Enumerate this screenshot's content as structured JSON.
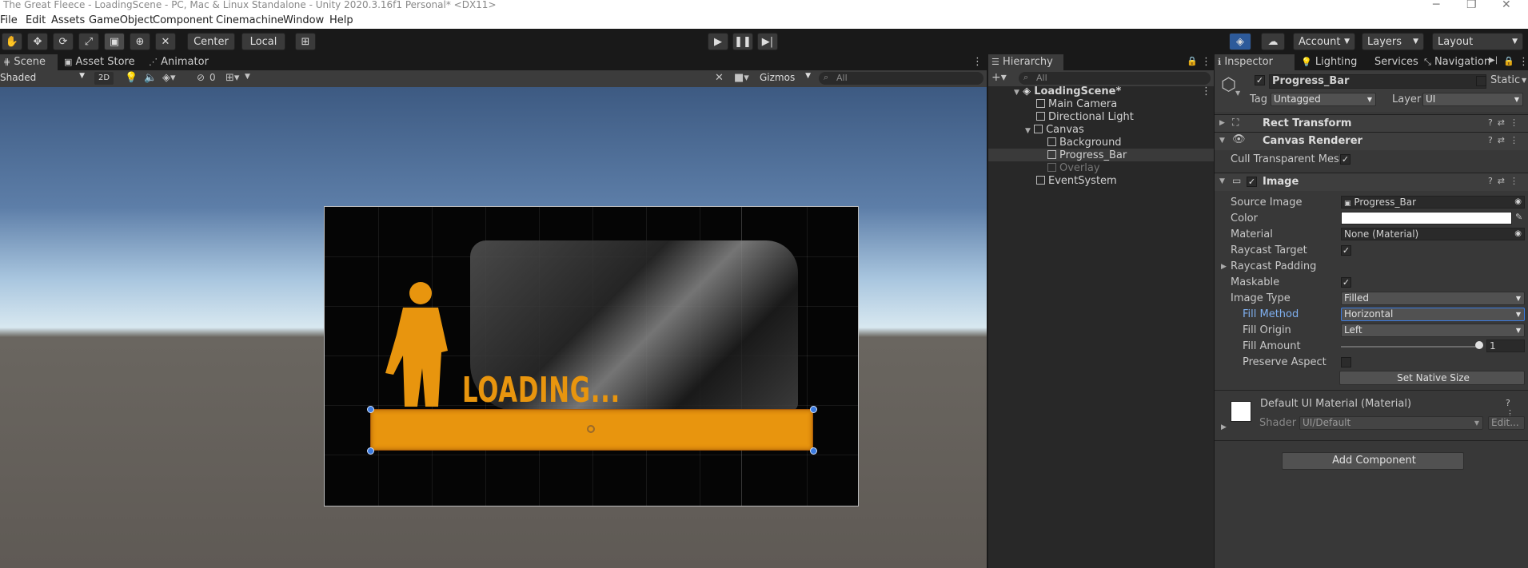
{
  "window": {
    "title": "The Great Fleece - LoadingScene - PC, Mac & Linux Standalone - Unity 2020.3.16f1 Personal* <DX11>"
  },
  "menu": [
    "File",
    "Edit",
    "Assets",
    "GameObject",
    "Component",
    "Cinemachine",
    "Window",
    "Help"
  ],
  "toolbar": {
    "pivot": "Center",
    "space": "Local",
    "account": "Account",
    "layers": "Layers",
    "layout": "Layout"
  },
  "scene_panel": {
    "tabs": [
      "Scene",
      "Asset Store",
      "Animator"
    ],
    "shading": "Shaded",
    "mode_2d": "2D",
    "hidden_count": "0",
    "gizmos": "Gizmos",
    "search_placeholder": "All",
    "canvas_text": "LOADING..."
  },
  "hierarchy": {
    "tab": "Hierarchy",
    "search_placeholder": "All",
    "items": [
      {
        "label": "LoadingScene*"
      },
      {
        "label": "Main Camera"
      },
      {
        "label": "Directional Light"
      },
      {
        "label": "Canvas"
      },
      {
        "label": "Background"
      },
      {
        "label": "Progress_Bar"
      },
      {
        "label": "Overlay"
      },
      {
        "label": "EventSystem"
      }
    ]
  },
  "inspector": {
    "tabs": [
      "Inspector",
      "Lighting",
      "Services",
      "Navigation"
    ],
    "object_name": "Progress_Bar",
    "static_label": "Static",
    "tag_label": "Tag",
    "tag_value": "Untagged",
    "layer_label": "Layer",
    "layer_value": "UI",
    "components": {
      "rect_transform": "Rect Transform",
      "canvas_renderer": "Canvas Renderer",
      "cull_transparent": "Cull Transparent Mesh",
      "image": "Image"
    },
    "image": {
      "source_image_label": "Source Image",
      "source_image_value": "Progress_Bar",
      "color_label": "Color",
      "material_label": "Material",
      "material_value": "None (Material)",
      "raycast_target_label": "Raycast Target",
      "raycast_padding_label": "Raycast Padding",
      "maskable_label": "Maskable",
      "image_type_label": "Image Type",
      "image_type_value": "Filled",
      "fill_method_label": "Fill Method",
      "fill_method_value": "Horizontal",
      "fill_origin_label": "Fill Origin",
      "fill_origin_value": "Left",
      "fill_amount_label": "Fill Amount",
      "fill_amount_value": "1",
      "preserve_aspect_label": "Preserve Aspect",
      "set_native_size": "Set Native Size"
    },
    "material": {
      "title": "Default UI Material (Material)",
      "shader_label": "Shader",
      "shader_value": "UI/Default",
      "edit_label": "Edit..."
    },
    "add_component": "Add Component"
  },
  "colors": {
    "accent_orange": "#e8950e",
    "selection_blue": "#3b7be0",
    "panel_bg": "#383838"
  }
}
